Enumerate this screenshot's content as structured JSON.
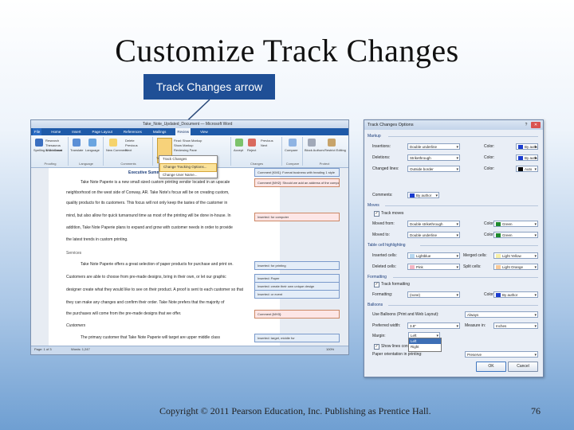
{
  "slide": {
    "title": "Customize Track Changes",
    "callout": "Track Changes arrow",
    "footer": "Copyright © 2011 Pearson Education, Inc. Publishing as Prentice Hall.",
    "page_number": "76"
  },
  "word": {
    "window_title": "Take_Note_Updated_Document — Microsoft Word",
    "tabs": [
      "File",
      "Home",
      "Insert",
      "Page Layout",
      "References",
      "Mailings",
      "Review",
      "View"
    ],
    "ribbon": {
      "proofing": "Proofing",
      "language": "Language",
      "comments": "Comments",
      "tracking": "Tracking",
      "changes": "Changes",
      "compare": "Compare",
      "protect": "Protect",
      "spelling": "Spelling & Grammar",
      "research": "Research",
      "thesaurus": "Thesaurus",
      "word_count": "Word Count",
      "translate": "Translate",
      "language_btn": "Language",
      "new_comment": "New Comment",
      "delete": "Delete",
      "previous": "Previous",
      "next": "Next",
      "track_changes": "Track Changes",
      "final_markup": "Final: Show Markup",
      "show_markup": "Show Markup",
      "reviewing_pane": "Reviewing Pane",
      "accept": "Accept",
      "reject": "Reject",
      "prev_change": "Previous",
      "next_change": "Next",
      "compare_btn": "Compare",
      "block_authors": "Block Authors",
      "restrict_editing": "Restrict Editing"
    },
    "track_menu": [
      "Track Changes",
      "Change Tracking Options...",
      "Change User Name..."
    ],
    "doc": {
      "heading": "Executive Summary",
      "lines": [
        "Take Note Paperie is a new small sized custom printing vendor located in an upscale",
        "neighborhood on the west side of Conway, AR. Take Note's focus will be on creating custom,",
        "quality products for its customers. This focus will not only keep the tastes of the customer in",
        "mind, but also allow for quick turnaround time as most of the printing will be done in-house. In",
        "addition, Take Note Paperie plans to expand and grow with customer needs in order to provide",
        "the latest trends in custom printing.",
        "Services",
        "Take Note Paperie offers a great selection of paper products for purchase and print on.",
        "Customers are able to choose from pre-made designs, bring in their own, or let our graphic",
        "designer create what they would like to see on their product. A proof is sent to each customer so that",
        "they can make any changes and confirm their order. Take Note prefers that the majority of",
        "the purchases will come from the pre-made designs that we offer.",
        "Customers",
        "The primary customer that Take Note Paperie will target are upper middle class"
      ],
      "balloons": [
        "Comment [KM1]: Format business with heading 1 style",
        "Comment [MH2]: Should we add an address of the company name?",
        "Inserted: for computer",
        "Inserted: for printing",
        "Inserted: Paper",
        "Inserted: create their own unique design",
        "Inserted: or event",
        "Comment [MH3]:",
        "Inserted: target, middle for"
      ]
    },
    "status": {
      "page": "Page: 1 of 3",
      "words": "Words: 1,247",
      "zoom": "100%"
    }
  },
  "dialog": {
    "title": "Track Changes Options",
    "help": "?",
    "close": "✕",
    "sections": {
      "markup": "Markup",
      "moves": "Moves",
      "table": "Table cell highlighting",
      "formatting": "Formatting",
      "balloons": "Balloons"
    },
    "markup": [
      {
        "label": "Insertions:",
        "value": "Double underline",
        "color_label": "Color:",
        "color": "By author",
        "swatch": "#1a3ccf"
      },
      {
        "label": "Deletions:",
        "value": "Strikethrough",
        "color_label": "Color:",
        "color": "By author",
        "swatch": "#1a3ccf"
      },
      {
        "label": "Changed lines:",
        "value": "Outside border",
        "color_label": "Color:",
        "color": "Auto",
        "swatch": "#000000"
      },
      {
        "label": "Comments:",
        "value": "By author",
        "swatch": "#1a3ccf"
      }
    ],
    "moves": {
      "track": "Track moves",
      "moved_from_label": "Moved from:",
      "moved_from": "Double strikethrough",
      "moved_from_color": "Green",
      "moved_to_label": "Moved to:",
      "moved_to": "Double underline",
      "moved_to_color": "Green",
      "color_label": "Color:"
    },
    "table": {
      "inserted_label": "Inserted cells:",
      "inserted": "Lightblue",
      "merged_label": "Merged cells:",
      "merged": "Light Yellow",
      "deleted_label": "Deleted cells:",
      "deleted": "Pink",
      "split_label": "Split cells:",
      "split": "Light Orange"
    },
    "formatting": {
      "track": "Track formatting",
      "label": "Formatting:",
      "value": "(none)",
      "color_label": "Color:",
      "color": "By author"
    },
    "balloons": {
      "use_label": "Use Balloons (Print and Web Layout):",
      "use": "Always",
      "width_label": "Preferred width:",
      "width": "3.8\"",
      "measure_label": "Measure in:",
      "measure": "Inches",
      "margin_label": "Margin:",
      "margin": "Left",
      "margin_options": [
        "Left",
        "Right"
      ],
      "show_lines": "Show lines connecting to text",
      "orientation_label": "Paper orientation in printing:",
      "orientation": "Preserve"
    },
    "ok": "OK",
    "cancel": "Cancel"
  },
  "colors": {
    "callout_bg": "#1f4f96",
    "accent": "#3d6fb6",
    "deletion": "#c0392b",
    "insertion": "#1a7a3a"
  }
}
